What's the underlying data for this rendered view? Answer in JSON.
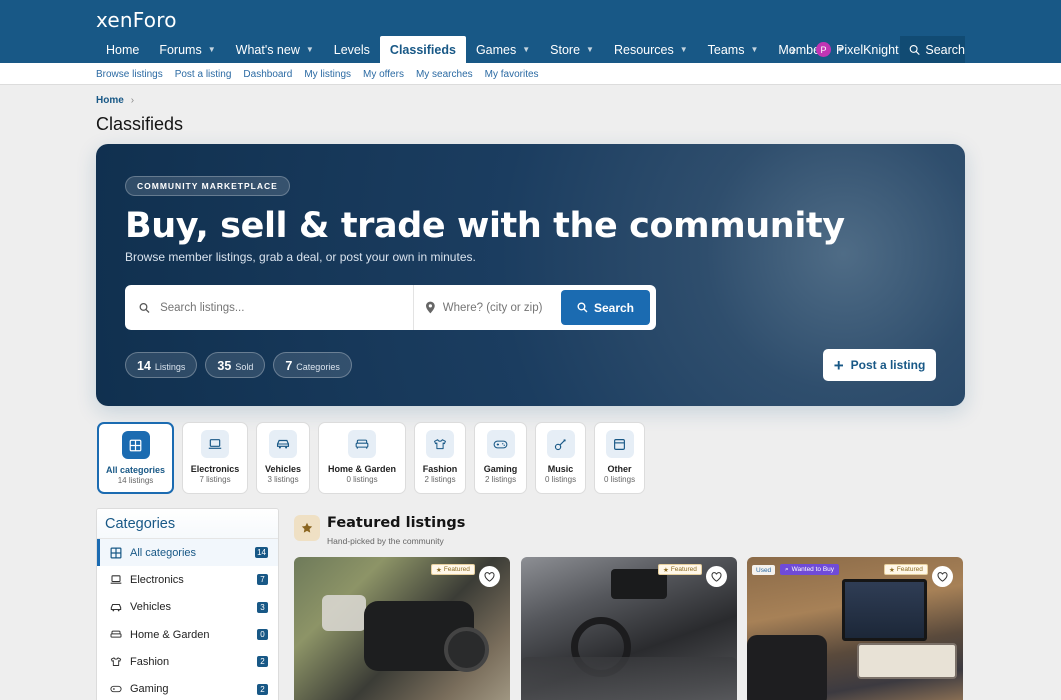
{
  "header": {
    "logo": "xenForo",
    "nav": [
      {
        "label": "Home",
        "dropdown": false
      },
      {
        "label": "Forums",
        "dropdown": true
      },
      {
        "label": "What's new",
        "dropdown": true
      },
      {
        "label": "Levels",
        "dropdown": false
      },
      {
        "label": "Classifieds",
        "dropdown": false,
        "active": true
      },
      {
        "label": "Games",
        "dropdown": true
      },
      {
        "label": "Store",
        "dropdown": true
      },
      {
        "label": "Resources",
        "dropdown": true
      },
      {
        "label": "Teams",
        "dropdown": true
      },
      {
        "label": "Members",
        "dropdown": true
      }
    ],
    "more_icon": "chevron-right-icon",
    "user": {
      "initial": "P",
      "name": "PixelKnight",
      "avatar_color": "#c135b4"
    },
    "search_label": "Search"
  },
  "subnav": [
    "Browse listings",
    "Post a listing",
    "Dashboard",
    "My listings",
    "My offers",
    "My searches",
    "My favorites"
  ],
  "breadcrumb": {
    "home": "Home"
  },
  "page_title": "Classifieds",
  "hero": {
    "badge": "COMMUNITY MARKETPLACE",
    "title": "Buy, sell & trade with the community",
    "subtitle": "Browse member listings, grab a deal, or post your own in minutes.",
    "search_placeholder": "Search listings...",
    "location_placeholder": "Where? (city or zip)",
    "search_button": "Search",
    "stats": [
      {
        "value": "14",
        "label": "Listings"
      },
      {
        "value": "35",
        "label": "Sold"
      },
      {
        "value": "7",
        "label": "Categories"
      }
    ],
    "post_button": "Post a listing"
  },
  "category_tiles": [
    {
      "name": "All categories",
      "count": "14 listings",
      "icon": "grid-icon",
      "active": true
    },
    {
      "name": "Electronics",
      "count": "7 listings",
      "icon": "laptop-icon"
    },
    {
      "name": "Vehicles",
      "count": "3 listings",
      "icon": "car-icon"
    },
    {
      "name": "Home & Garden",
      "count": "0 listings",
      "icon": "sofa-icon"
    },
    {
      "name": "Fashion",
      "count": "2 listings",
      "icon": "shirt-icon"
    },
    {
      "name": "Gaming",
      "count": "2 listings",
      "icon": "gamepad-icon"
    },
    {
      "name": "Music",
      "count": "0 listings",
      "icon": "guitar-icon"
    },
    {
      "name": "Other",
      "count": "0 listings",
      "icon": "box-icon"
    }
  ],
  "sidebar": {
    "title": "Categories",
    "items": [
      {
        "label": "All categories",
        "count": "14",
        "icon": "grid-icon",
        "active": true
      },
      {
        "label": "Electronics",
        "count": "7",
        "icon": "laptop-icon"
      },
      {
        "label": "Vehicles",
        "count": "3",
        "icon": "car-icon"
      },
      {
        "label": "Home & Garden",
        "count": "0",
        "icon": "sofa-icon"
      },
      {
        "label": "Fashion",
        "count": "2",
        "icon": "shirt-icon"
      },
      {
        "label": "Gaming",
        "count": "2",
        "icon": "gamepad-icon"
      }
    ]
  },
  "featured": {
    "title": "Featured listings",
    "subtitle": "Hand-picked by the community",
    "badge_label": "Featured",
    "cards": [
      {
        "image": "camera-photo",
        "badges": []
      },
      {
        "image": "car-interior-photo",
        "badges": []
      },
      {
        "image": "laptop-keyboard-photo",
        "badges": [
          "Used",
          "Wanted to Buy"
        ]
      }
    ]
  },
  "colors": {
    "brand": "#185886",
    "accent": "#1b6bb1",
    "avatar": "#c135b4",
    "wanted_badge": "#6f4bd8"
  }
}
